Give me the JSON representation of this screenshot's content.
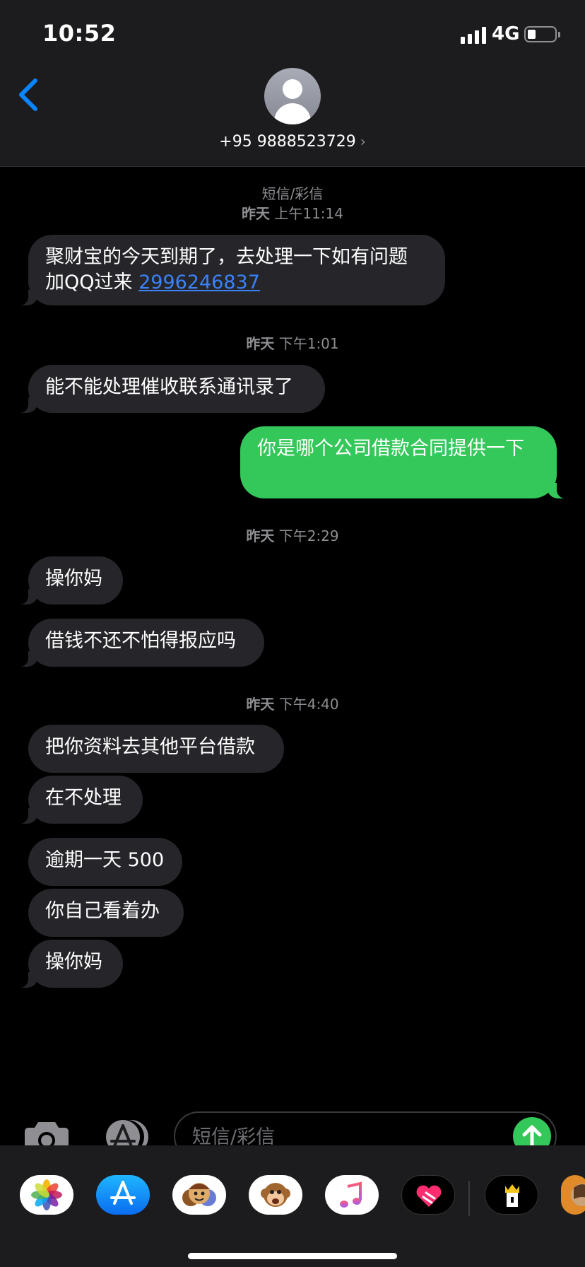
{
  "status_bar": {
    "time": "10:52",
    "network": "4G",
    "battery_level": 0.3
  },
  "header": {
    "contact": "+95 9888523729",
    "chevron": "›"
  },
  "thread": {
    "meta1_type": "短信/彩信",
    "meta1_day": "昨天",
    "meta1_time": "上午11:14",
    "m1_line1": "聚财宝的今天到期了，去处理一下如有问题",
    "m1_line2_prefix": "加QQ过来 ",
    "m1_line2_link": "2996246837",
    "meta2_day": "昨天",
    "meta2_time": "下午1:01",
    "m2": "能不能处理催收联系通讯录了",
    "m3_out": "你是哪个公司借款合同提供一下",
    "meta3_day": "昨天",
    "meta3_time": "下午2:29",
    "m4": "操你妈",
    "m5": "借钱不还不怕得报应吗",
    "meta4_day": "昨天",
    "meta4_time": "下午4:40",
    "m6": "把你资料去其他平台借款",
    "m7": "在不处理",
    "m8": "逾期一天 500",
    "m9": "你自己看着办",
    "m10": "操你妈"
  },
  "compose": {
    "placeholder": "短信/彩信"
  },
  "app_drawer": [
    "photos-icon",
    "app-store-icon",
    "memoji-icon",
    "animoji-icon",
    "music-icon",
    "digital-touch-icon",
    "game-icon",
    "sticker-icon"
  ],
  "colors": {
    "incoming": "#26252a",
    "outgoing": "#34c759",
    "link": "#3b82f6",
    "accent": "#0a84ff"
  }
}
